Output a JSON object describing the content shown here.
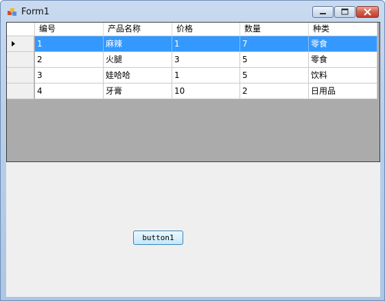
{
  "window": {
    "title": "Form1"
  },
  "grid": {
    "columns": [
      "编号",
      "产品名称",
      "价格",
      "数量",
      "种类"
    ],
    "rows": [
      [
        "1",
        "麻辣",
        "1",
        "7",
        "零食"
      ],
      [
        "2",
        "火腿",
        "3",
        "5",
        "零食"
      ],
      [
        "3",
        "娃哈哈",
        "1",
        "5",
        "饮料"
      ],
      [
        "4",
        "牙膏",
        "10",
        "2",
        "日用品"
      ]
    ],
    "selected_row": 0
  },
  "button1": {
    "label": "button1"
  },
  "colors": {
    "selection": "#3399ff",
    "grid_background": "#ababab",
    "client_background": "#efefef"
  }
}
